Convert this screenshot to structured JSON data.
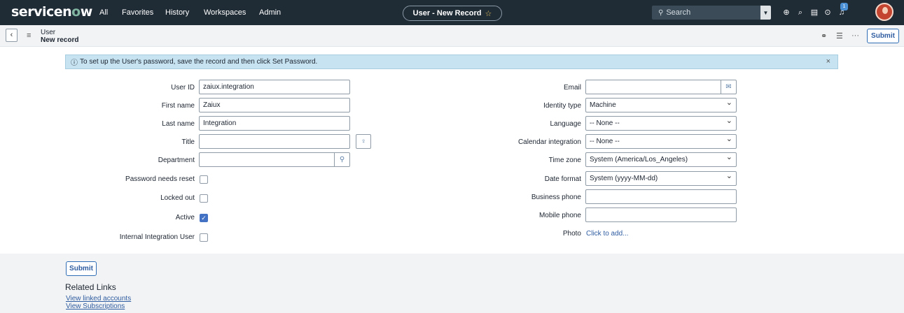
{
  "topbar": {
    "logo_a": "servicen",
    "logo_o": "o",
    "logo_b": "w",
    "nav": [
      "All",
      "Favorites",
      "History",
      "Workspaces",
      "Admin"
    ],
    "record_title": "User - New Record",
    "search_placeholder": "Search",
    "notification_count": "1"
  },
  "header": {
    "breadcrumb_table": "User",
    "breadcrumb_record": "New record",
    "submit_label": "Submit"
  },
  "info_message": "To set up the User's password, save the record and then click Set Password.",
  "left": {
    "user_id_label": "User ID",
    "user_id_value": "zaiux.integration",
    "first_name_label": "First name",
    "first_name_value": "Zaiux",
    "last_name_label": "Last name",
    "last_name_value": "Integration",
    "title_label": "Title",
    "department_label": "Department",
    "password_reset_label": "Password needs reset",
    "locked_out_label": "Locked out",
    "active_label": "Active",
    "internal_integration_label": "Internal Integration User"
  },
  "right": {
    "email_label": "Email",
    "identity_type_label": "Identity type",
    "identity_type_value": "Machine",
    "language_label": "Language",
    "language_value": "-- None --",
    "calendar_label": "Calendar integration",
    "calendar_value": "-- None --",
    "timezone_label": "Time zone",
    "timezone_value": "System (America/Los_Angeles)",
    "date_format_label": "Date format",
    "date_format_value": "System (yyyy-MM-dd)",
    "business_phone_label": "Business phone",
    "mobile_phone_label": "Mobile phone",
    "photo_label": "Photo",
    "photo_link": "Click to add..."
  },
  "checkboxes": {
    "password_needs_reset": false,
    "locked_out": false,
    "active": true,
    "internal_integration_user": false
  },
  "footer": {
    "submit_label": "Submit",
    "related_links_title": "Related Links",
    "links": [
      "View linked accounts",
      "View Subscriptions"
    ]
  },
  "colors": {
    "topbar": "#1f2b35",
    "info_bg": "#c7e3f1",
    "accent": "#2f5da1",
    "checkbox_on": "#4372c4"
  }
}
